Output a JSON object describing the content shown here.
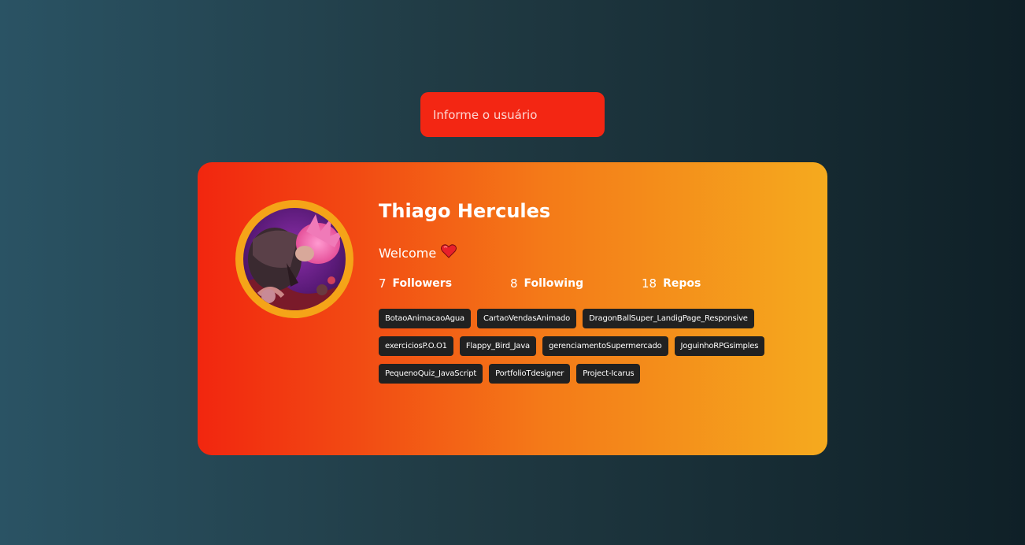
{
  "search": {
    "placeholder": "Informe o usuário",
    "value": ""
  },
  "profile": {
    "name": "Thiago Hercules",
    "bio": "Welcome",
    "bio_icon": "heart-icon",
    "avatar_icon": "profile-avatar-image",
    "stats": [
      {
        "value": "7",
        "label": "Followers"
      },
      {
        "value": "8",
        "label": "Following"
      },
      {
        "value": "18",
        "label": "Repos"
      }
    ],
    "repos": [
      "BotaoAnimacaoAgua",
      "CartaoVendasAnimado",
      "DragonBallSuper_LandigPage_Responsive",
      "exerciciosP.O.O1",
      "Flappy_Bird_Java",
      "gerenciamentoSupermercado",
      "JoguinhoRPGsimples",
      "PequenoQuiz_JavaScript",
      "PortfolioTdesigner",
      "Project-Icarus"
    ]
  },
  "colors": {
    "search_bg": "#f32613",
    "card_gradient_start": "#f2260f",
    "card_gradient_end": "#f5aa1e",
    "avatar_ring": "#f5a418",
    "repo_tag_bg": "#212121",
    "page_gradient_start": "#2a5364",
    "page_gradient_end": "#0f2027"
  }
}
